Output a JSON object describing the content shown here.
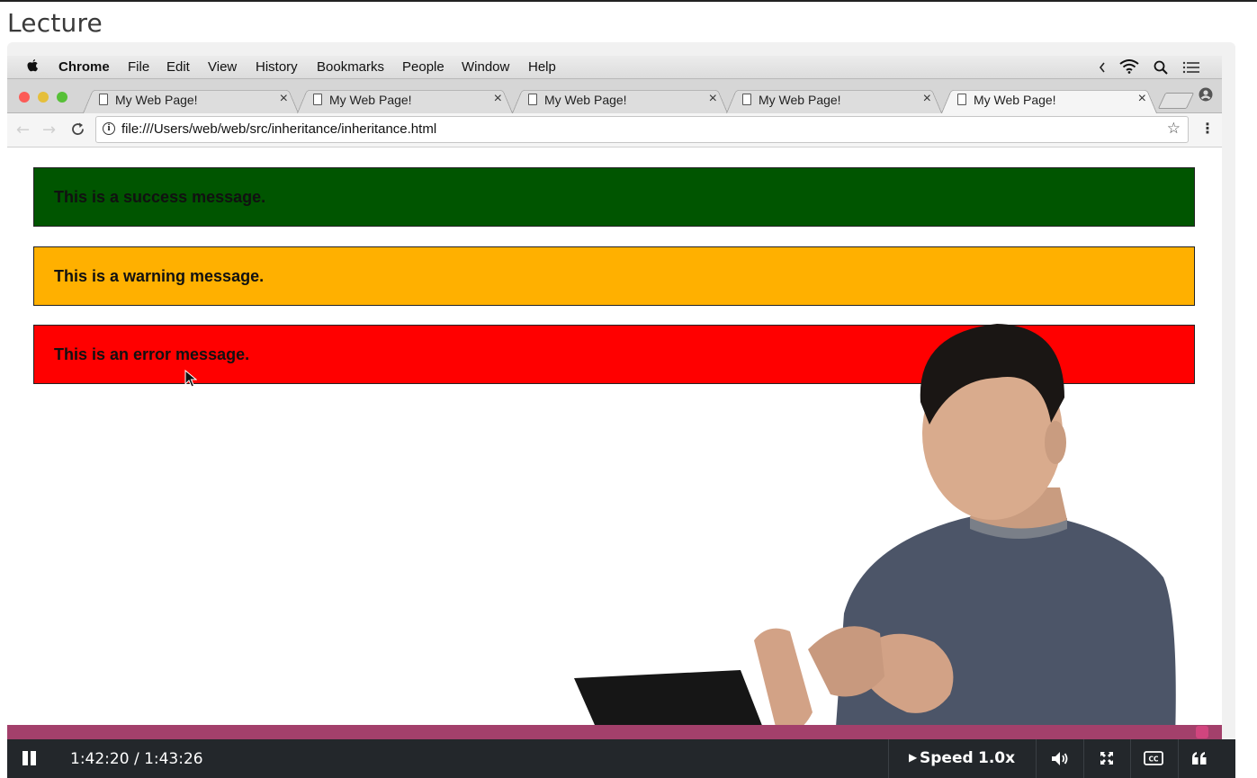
{
  "page": {
    "title": "Lecture"
  },
  "menubar": {
    "app": "Chrome",
    "items": [
      "File",
      "Edit",
      "View",
      "History",
      "Bookmarks",
      "People",
      "Window",
      "Help"
    ],
    "icons": [
      "apple-icon",
      "chevron-left-icon",
      "wifi-icon",
      "search-icon",
      "list-icon"
    ]
  },
  "tabs": [
    {
      "title": "My Web Page!",
      "active": false
    },
    {
      "title": "My Web Page!",
      "active": false
    },
    {
      "title": "My Web Page!",
      "active": false
    },
    {
      "title": "My Web Page!",
      "active": false
    },
    {
      "title": "My Web Page!",
      "active": true
    }
  ],
  "tab_close_glyph": "×",
  "address_bar": {
    "url": "file:///Users/web/web/src/inheritance/inheritance.html"
  },
  "messages": [
    {
      "text": "This is a success message.",
      "color": "#005500"
    },
    {
      "text": "This is a warning message.",
      "color": "#ffb000"
    },
    {
      "text": "This is an error message.",
      "color": "#ff0000"
    }
  ],
  "player": {
    "progress": 0.989,
    "time": "1:42:20 / 1:43:26",
    "speed_label": "Speed",
    "speed_value": "1.0x",
    "accent_color": "#a3406b"
  }
}
